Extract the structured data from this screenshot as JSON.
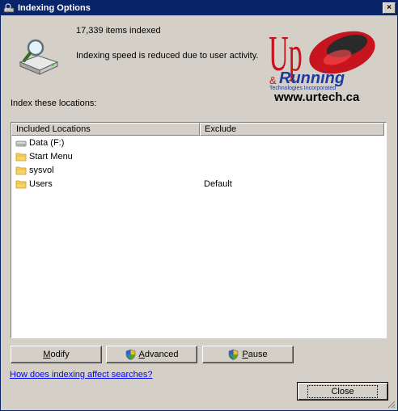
{
  "window": {
    "title": "Indexing Options",
    "close_glyph": "×"
  },
  "status": {
    "items_indexed": "17,339 items indexed",
    "speed_message": "Indexing speed is reduced due to user activity."
  },
  "logo": {
    "url_text": "www.urtech.ca",
    "lettering": [
      "Up",
      "&",
      "Running",
      "Technologies Incorporated"
    ],
    "colors": {
      "red": "#c8141e",
      "blue": "#1e3a9e"
    }
  },
  "locations": {
    "label": "Index these locations:",
    "columns": [
      "Included Locations",
      "Exclude"
    ],
    "rows": [
      {
        "name": "Data (F:)",
        "exclude": "",
        "icon": "drive-icon"
      },
      {
        "name": "Start Menu",
        "exclude": "",
        "icon": "folder-icon"
      },
      {
        "name": "sysvol",
        "exclude": "",
        "icon": "folder-icon"
      },
      {
        "name": "Users",
        "exclude": "Default",
        "icon": "folder-icon"
      }
    ]
  },
  "buttons": {
    "modify": {
      "pre": "",
      "accel": "M",
      "post": "odify"
    },
    "advanced": {
      "pre": "",
      "accel": "A",
      "post": "dvanced"
    },
    "pause": {
      "pre": "",
      "accel": "P",
      "post": "ause"
    },
    "close": "Close"
  },
  "help_link": "How does indexing affect searches?"
}
